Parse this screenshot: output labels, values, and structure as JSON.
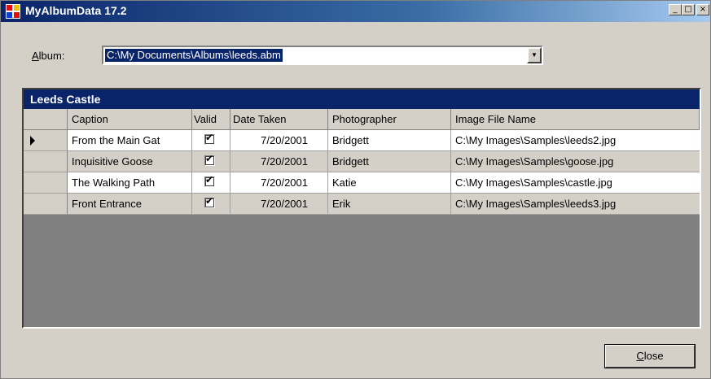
{
  "window": {
    "title": "MyAlbumData 17.2",
    "icon": "app-icon"
  },
  "album": {
    "label_prefix": "A",
    "label_rest": "lbum:",
    "path": "C:\\My Documents\\Albums\\leeds.abm"
  },
  "grid": {
    "caption": "Leeds Castle",
    "columns": [
      "Caption",
      "Valid",
      "Date Taken",
      "Photographer",
      "Image File Name"
    ],
    "rows": [
      {
        "caption": "From the Main Gat",
        "valid": true,
        "date": "7/20/2001",
        "photographer": "Bridgett",
        "file": "C:\\My Images\\Samples\\leeds2.jpg"
      },
      {
        "caption": "Inquisitive Goose",
        "valid": true,
        "date": "7/20/2001",
        "photographer": "Bridgett",
        "file": "C:\\My Images\\Samples\\goose.jpg"
      },
      {
        "caption": "The Walking Path",
        "valid": true,
        "date": "7/20/2001",
        "photographer": "Katie",
        "file": "C:\\My Images\\Samples\\castle.jpg"
      },
      {
        "caption": "Front Entrance",
        "valid": true,
        "date": "7/20/2001",
        "photographer": "Erik",
        "file": "C:\\My Images\\Samples\\leeds3.jpg"
      }
    ]
  },
  "buttons": {
    "close_prefix": "C",
    "close_rest": "lose"
  },
  "colors": {
    "titlebar": "#0a246a",
    "selection": "#0a246a",
    "face": "#d4d0c8"
  }
}
